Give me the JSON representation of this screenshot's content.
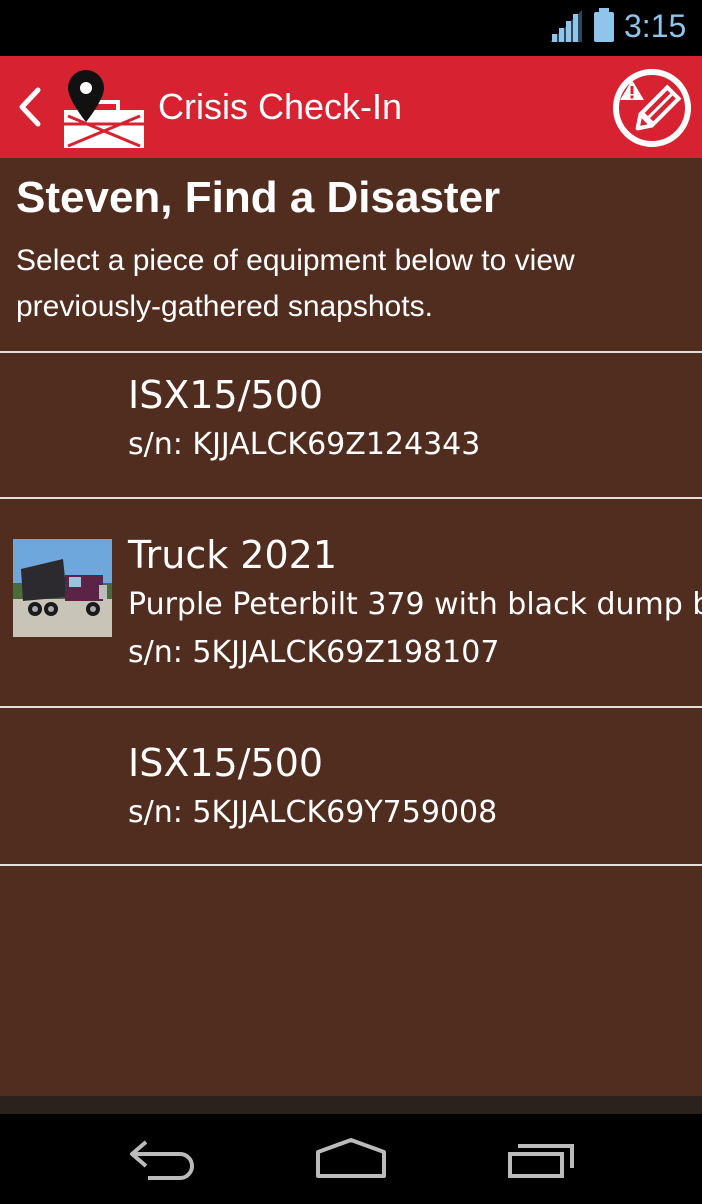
{
  "status_bar": {
    "time": "3:15",
    "signal_icon": "signal-icon",
    "battery_icon": "battery-icon"
  },
  "app_bar": {
    "back_icon": "chevron-left-icon",
    "logo_icon": "map-pin-briefcase-icon",
    "title": "Crisis Check-In",
    "report_icon": "warning-pencil-icon"
  },
  "header": {
    "title": "Steven, Find a Disaster",
    "subtitle_line1": "Select a piece of equipment below to view",
    "subtitle_line2": "previously-gathered snapshots."
  },
  "equipment": [
    {
      "name": "ISX15/500",
      "serial": "s/n: KJJALCK69Z124343"
    },
    {
      "name": "Truck 2021",
      "description": "Purple Peterbilt 379 with black dump b",
      "serial": "s/n: 5KJJALCK69Z198107",
      "thumbnail": "truck-photo"
    },
    {
      "name": "ISX15/500",
      "serial": "s/n: 5KJJALCK69Y759008"
    }
  ],
  "colors": {
    "app_bar": "#d62231",
    "background": "#512d20",
    "status_clock": "#8fc5ea"
  },
  "nav_bar": {
    "back_icon": "back-arrow-icon",
    "home_icon": "home-icon",
    "recents_icon": "recents-icon"
  }
}
